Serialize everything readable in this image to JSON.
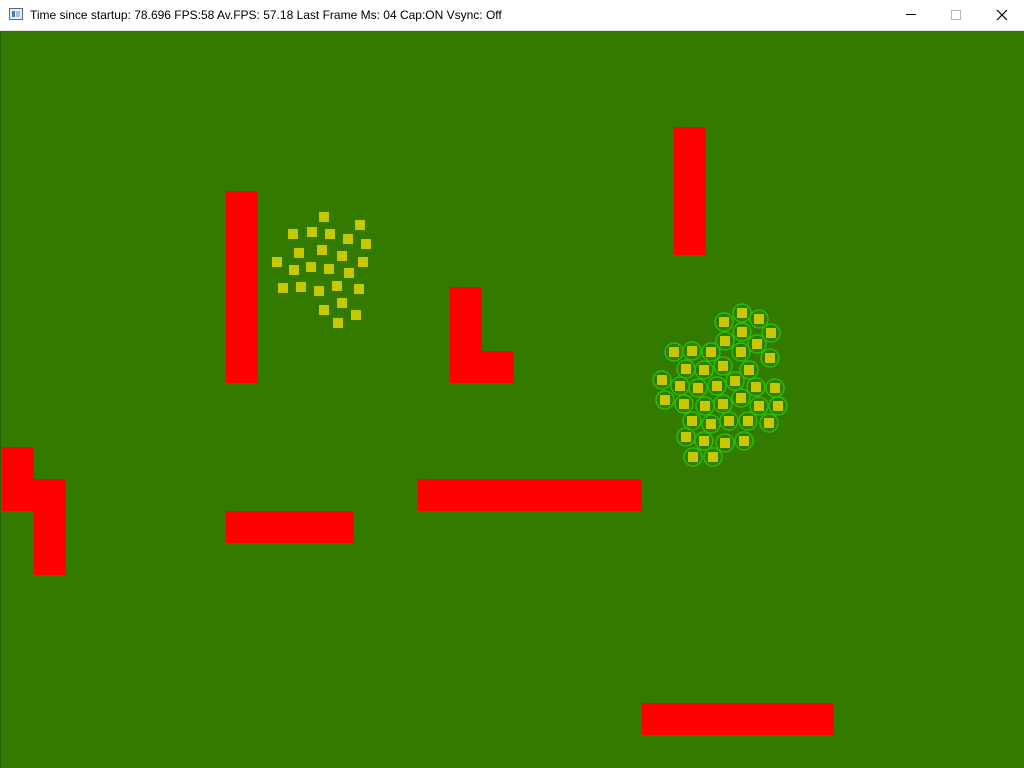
{
  "window": {
    "title": "Time since startup: 78.696 FPS:58 Av.FPS: 57.18 Last Frame Ms: 04 Cap:ON Vsync: Off",
    "app_icon": "app-window-icon",
    "controls": {
      "minimize_icon": "minimize-icon",
      "maximize_icon": "maximize-icon",
      "close_icon": "close-icon"
    }
  },
  "colors": {
    "background": "#337a00",
    "wall": "#ff0000",
    "unit": "#c8c800",
    "selection_ring": "#22c400"
  }
}
